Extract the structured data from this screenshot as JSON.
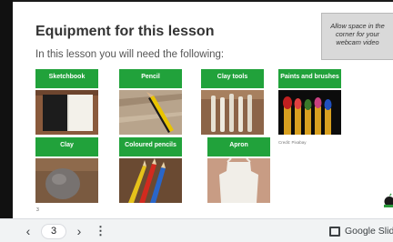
{
  "slide": {
    "title": "Equipment for this lesson",
    "subtitle": "In this lesson you will need the following:",
    "note": "Allow space in the corner for your webcam video",
    "credit": "Credit: Pixabay",
    "slide_number": "3"
  },
  "cards": [
    {
      "label": "Sketchbook"
    },
    {
      "label": "Pencil"
    },
    {
      "label": "Clay tools"
    },
    {
      "label": "Paints and brushes"
    },
    {
      "label": "Clay"
    },
    {
      "label": "Coloured pencils"
    },
    {
      "label": "Apron"
    }
  ],
  "toolbar": {
    "prev": "‹",
    "page": "3",
    "next": "›",
    "more": "⋮",
    "brand": "Google Slides"
  },
  "colors": {
    "label_green": "#21a23b",
    "note_bg": "#d9d9d9",
    "toolbar_bg": "#f1f3f4"
  }
}
